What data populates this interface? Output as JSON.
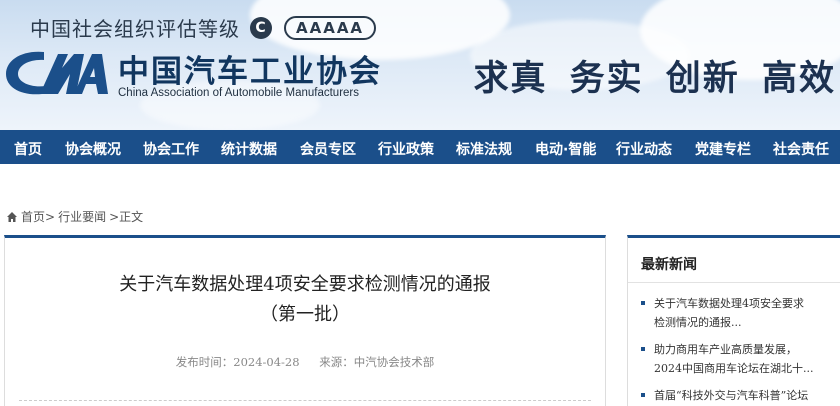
{
  "header": {
    "eval_text": "中国社会组织评估等级",
    "eval_c": "C",
    "eval_level": "AAAAA",
    "org_cn": "中国汽车工业协会",
    "org_en": "China Association of Automobile Manufacturers",
    "slogan": "求真 务实 创新 高效"
  },
  "nav": {
    "items": [
      {
        "label": "首页"
      },
      {
        "label": "协会概况"
      },
      {
        "label": "协会工作"
      },
      {
        "label": "统计数据"
      },
      {
        "label": "会员专区"
      },
      {
        "label": "行业政策"
      },
      {
        "label": "标准法规"
      },
      {
        "label": "电动·智能"
      },
      {
        "label": "行业动态"
      },
      {
        "label": "党建专栏"
      },
      {
        "label": "社会责任"
      }
    ]
  },
  "breadcrumb": {
    "home": "首页>",
    "section": "行业要闻",
    "current": ">正文"
  },
  "article": {
    "title": "关于汽车数据处理4项安全要求检测情况的通报",
    "subtitle": "（第一批）",
    "publish_time": "发布时间：2024-04-28",
    "source": "来源：中汽协会技术部"
  },
  "sidebar": {
    "title": "最新新闻",
    "news": [
      {
        "line1": "关于汽车数据处理4项安全要求",
        "line2": "检测情况的通报..."
      },
      {
        "line1": "助力商用车产业高质量发展，",
        "line2": "2024中国商用车论坛在湖北十..."
      },
      {
        "line1": "首届“科技外交与汽车科普”论坛",
        "line2": ""
      }
    ]
  },
  "colors": {
    "nav_bg": "#1b4f8a",
    "brand_dark": "#11365f"
  }
}
